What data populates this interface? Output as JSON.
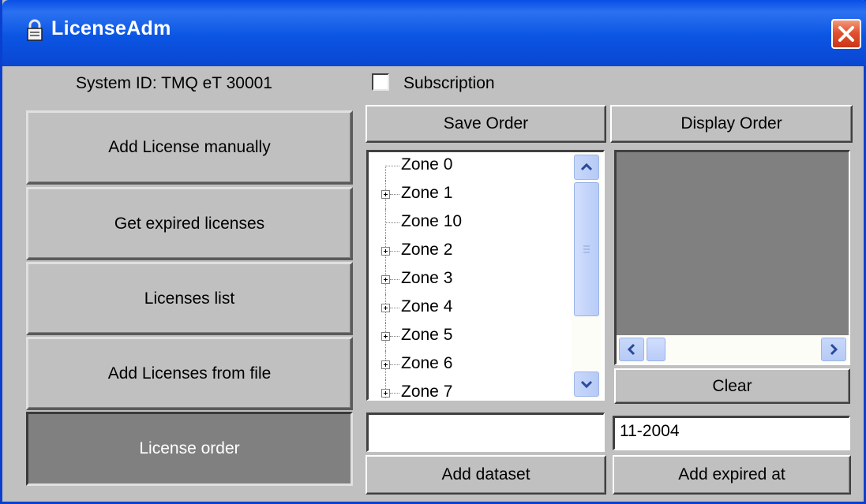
{
  "window": {
    "title": "LicenseAdm",
    "title_icon": "lock-icon",
    "close_icon": "close-icon"
  },
  "system_id_label": "System ID: TMQ eT 30001",
  "subscription": {
    "label": "Subscription",
    "checked": false
  },
  "left_buttons": [
    {
      "label": "Add License manually"
    },
    {
      "label": "Get expired licenses"
    },
    {
      "label": "Licenses list"
    },
    {
      "label": "Add Licenses from file"
    },
    {
      "label": "License order",
      "active": true
    }
  ],
  "top_buttons": {
    "save_order": "Save Order",
    "display_order": "Display Order"
  },
  "tree": {
    "items": [
      {
        "label": "Zone 0",
        "expandable": false
      },
      {
        "label": "Zone 1",
        "expandable": true
      },
      {
        "label": "Zone 10",
        "expandable": false
      },
      {
        "label": "Zone 2",
        "expandable": true
      },
      {
        "label": "Zone 3",
        "expandable": true
      },
      {
        "label": "Zone 4",
        "expandable": true
      },
      {
        "label": "Zone 5",
        "expandable": true
      },
      {
        "label": "Zone 6",
        "expandable": true
      },
      {
        "label": "Zone 7",
        "expandable": true
      }
    ]
  },
  "clear_button": "Clear",
  "dataset_input": {
    "value": ""
  },
  "expired_input": {
    "value": "11-2004"
  },
  "add_dataset_button": "Add dataset",
  "add_expired_button": "Add expired at",
  "colors": {
    "titlebar": "#0a4fe6",
    "face": "#c0c0c0",
    "active_button": "#808080",
    "scrollbar": "#b6caf5"
  }
}
